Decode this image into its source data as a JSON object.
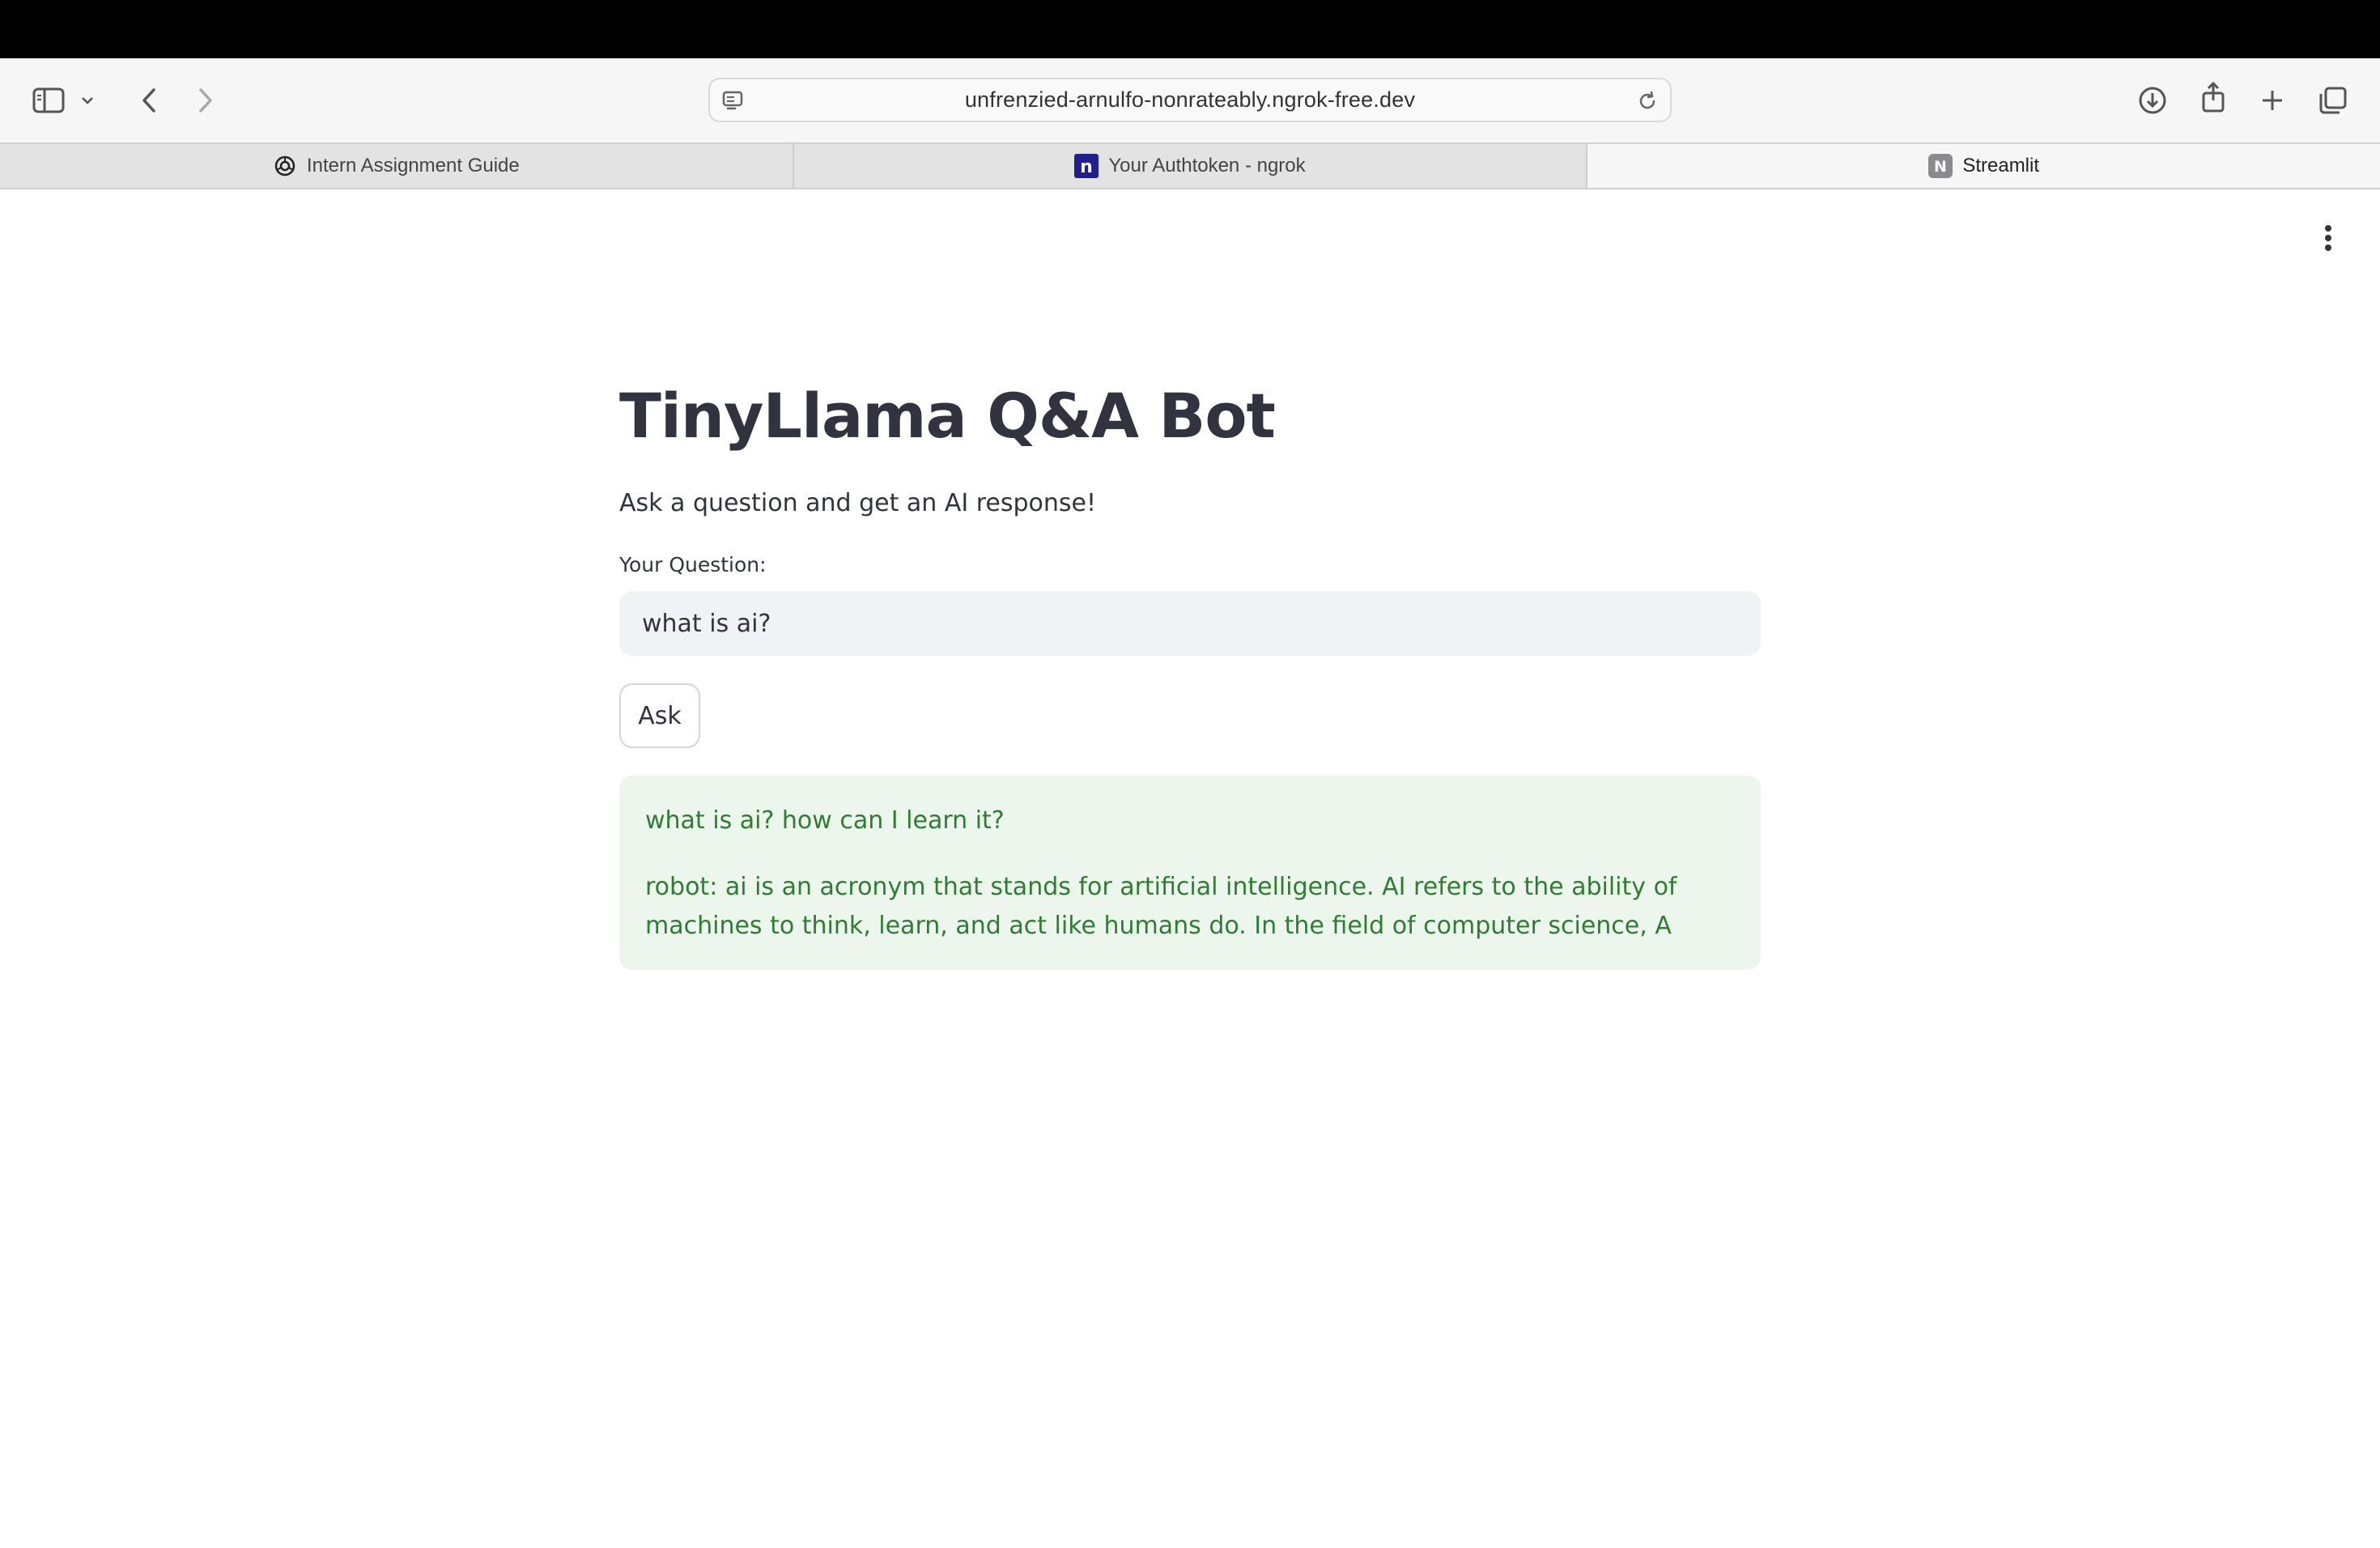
{
  "browser": {
    "url": "unfrenzied-arnulfo-nonrateably.ngrok-free.dev",
    "tabs": [
      {
        "label": "Intern Assignment Guide",
        "icon": "openai-icon",
        "active": false
      },
      {
        "label": "Your Authtoken - ngrok",
        "icon": "ngrok-icon",
        "active": false
      },
      {
        "label": "Streamlit",
        "icon": "streamlit-n-icon",
        "active": true
      }
    ],
    "streamlit_favicon_letter": "N",
    "ngrok_favicon_letter": "n"
  },
  "app": {
    "title": "TinyLlama Q&A Bot",
    "subtitle": "Ask a question and get an AI response!",
    "question_label": "Your Question:",
    "question_value": "what is ai?",
    "ask_label": "Ask",
    "response_question": "what is ai? how can I learn it?",
    "response_answer": "robot: ai is an acronym that stands for artificial intelligence. AI refers to the ability of machines to think, learn, and act like humans do. In the field of computer science, A"
  },
  "colors": {
    "answer_bg": "#ecf6ec",
    "answer_text": "#2e7d32",
    "input_bg": "#f0f2f6",
    "title_text": "#31333f"
  }
}
